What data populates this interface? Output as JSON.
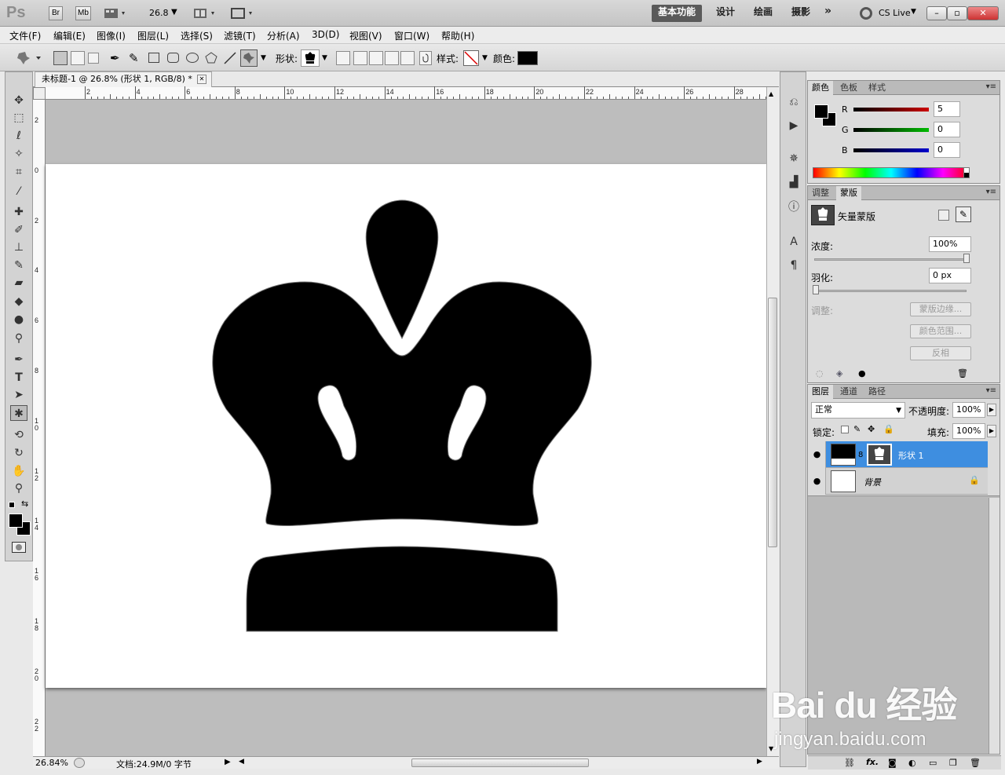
{
  "app": {
    "logo": "Ps",
    "bridge_label": "Br",
    "minibridge_label": "Mb",
    "zoom_value": "26.8",
    "workspaces": [
      "基本功能",
      "设计",
      "绘画",
      "摄影"
    ],
    "more_workspaces": "»",
    "cs_live": "CS Live",
    "window_buttons": [
      "–",
      "▫",
      "✕"
    ]
  },
  "menu": [
    "文件(F)",
    "编辑(E)",
    "图像(I)",
    "图层(L)",
    "选择(S)",
    "滤镜(T)",
    "分析(A)",
    "3D(D)",
    "视图(V)",
    "窗口(W)",
    "帮助(H)"
  ],
  "options": {
    "shape_label": "形状:",
    "style_label": "样式:",
    "color_label": "颜色:"
  },
  "document": {
    "tab_title": "未标题-1 @ 26.8% (形状 1, RGB/8) *",
    "close": "✕",
    "ruler_h": [
      "2",
      "4",
      "6",
      "8",
      "10",
      "12",
      "14",
      "16",
      "18",
      "20",
      "22",
      "24",
      "26",
      "28"
    ],
    "ruler_v": [
      "2",
      "0",
      "2",
      "4",
      "6",
      "8",
      "1\n0",
      "1\n2",
      "1\n4",
      "1\n6",
      "1\n8",
      "2\n0",
      "2\n2"
    ]
  },
  "status": {
    "zoom": "26.84%",
    "doc_info": "文档:24.9M/0 字节"
  },
  "color_panel": {
    "tabs": [
      "颜色",
      "色板",
      "样式"
    ],
    "channels": [
      {
        "label": "R",
        "value": "5",
        "color": "#cc0000"
      },
      {
        "label": "G",
        "value": "0",
        "color": "#00aa00"
      },
      {
        "label": "B",
        "value": "0",
        "color": "#0000cc"
      }
    ]
  },
  "masks_panel": {
    "tabs": [
      "调整",
      "蒙版"
    ],
    "mask_type": "矢量蒙版",
    "density_label": "浓度:",
    "density_value": "100%",
    "feather_label": "羽化:",
    "feather_value": "0 px",
    "refine_label": "调整:",
    "buttons": [
      "蒙版边缘...",
      "颜色范围...",
      "反相"
    ]
  },
  "layers_panel": {
    "tabs": [
      "图层",
      "通道",
      "路径"
    ],
    "blend_mode": "正常",
    "opacity_label": "不透明度:",
    "opacity_value": "100%",
    "lock_label": "锁定:",
    "fill_label": "填充:",
    "fill_value": "100%",
    "layers": [
      {
        "name": "形状 1",
        "selected": true
      },
      {
        "name": "背景",
        "selected": false
      }
    ]
  },
  "watermark": {
    "brand": "Bai du 经验",
    "url": "jingyan.baidu.com"
  }
}
